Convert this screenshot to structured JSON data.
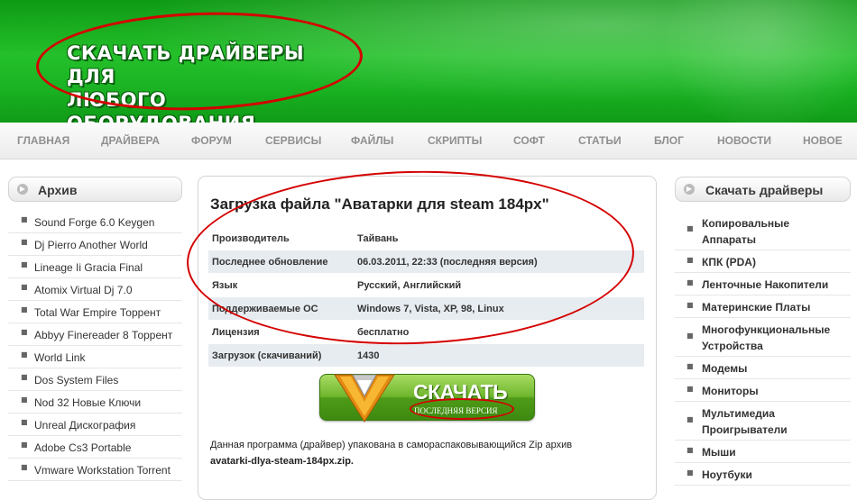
{
  "header": {
    "title_line1": "СКАЧАТЬ ДРАЙВЕРЫ ДЛЯ",
    "title_line2": "ЛЮБОГО ОБОРУДОВАНИЯ"
  },
  "nav": [
    "ГЛАВНАЯ",
    "ДРАЙВЕРА",
    "ФОРУМ",
    "СЕРВИСЫ",
    "ФАЙЛЫ",
    "СКРИПТЫ",
    "СОФТ",
    "СТАТЬИ",
    "БЛОГ",
    "НОВОСТИ",
    "НОВОЕ"
  ],
  "left_sidebar": {
    "title": "Архив",
    "items": [
      "Sound Forge 6.0 Keygen",
      "Dj Pierro Another World",
      "Lineage Ii Gracia Final",
      "Atomix Virtual Dj 7.0",
      "Total War Empire Торрент",
      "Abbyy Finereader 8 Торрент",
      "World Link",
      "Dos System Files",
      "Nod 32 Новые Ключи",
      "Unreal Дискография",
      "Adobe Cs3 Portable",
      "Vmware Workstation Torrent"
    ]
  },
  "right_sidebar": {
    "title": "Скачать драйверы",
    "items": [
      [
        "Копировальные",
        "Аппараты"
      ],
      [
        "КПК (PDA)"
      ],
      [
        "Ленточные Накопители"
      ],
      [
        "Материнские Платы"
      ],
      [
        "Многофункциональные",
        "Устройства"
      ],
      [
        "Модемы"
      ],
      [
        "Мониторы"
      ],
      [
        "Мультимедиа",
        "Проигрыватели"
      ],
      [
        "Мыши"
      ],
      [
        "Ноутбуки"
      ]
    ]
  },
  "main": {
    "title": "Загрузка файла \"Аватарки для steam 184px\"",
    "rows": [
      [
        "Производитель",
        "Тайвань"
      ],
      [
        "Последнее обновление",
        "06.03.2011, 22:33 (последняя версия)"
      ],
      [
        "Язык",
        "Русский, Английский"
      ],
      [
        "Поддерживаемые ОС",
        "Windows 7, Vista, XP, 98, Linux"
      ],
      [
        "Лицензия",
        "бесплатно"
      ],
      [
        "Загрузок (скачиваний)",
        "1430"
      ]
    ],
    "download_label": "СКАЧАТЬ",
    "download_sub": "ПОСЛЕДНЯЯ ВЕРСИЯ",
    "note": "Данная программа (драйвер) упакована в самораспаковывающийся Zip архив",
    "file_name": "avatarki-dlya-steam-184px.zip."
  },
  "colors": {
    "header_green": "#1bb424",
    "annotation_red": "#d40000",
    "table_stripe": "#e7ecf1"
  }
}
